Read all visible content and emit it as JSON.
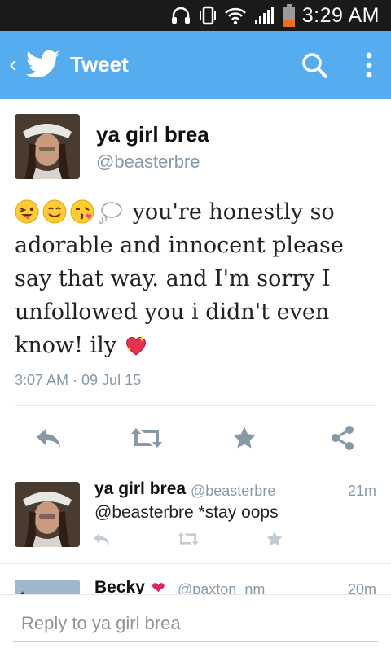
{
  "status_bar": {
    "time": "3:29 AM",
    "icons": [
      "headphones-icon",
      "vibrate-icon",
      "wifi-icon",
      "signal-icon",
      "battery-icon"
    ]
  },
  "app_bar": {
    "back_label": "‹",
    "title": "Tweet",
    "icons": [
      "twitter-bird-icon",
      "search-icon",
      "more-options-icon"
    ],
    "color": "#55acee"
  },
  "tweet": {
    "display_name": "ya girl brea",
    "handle": "@beasterbre",
    "text": "you're honestly so adorable and innocent please say that way. and I'm sorry I unfollowed you i didn't even know! ily",
    "leading_emoji": [
      "stuck-out-tongue-winking-emoji",
      "smiling-face-emoji",
      "kissing-face-emoji",
      "thought-balloon-emoji"
    ],
    "trailing_emoji": [
      "sparkling-heart-emoji"
    ],
    "timestamp": "3:07 AM · 09 Jul 15",
    "actions": [
      "reply-icon",
      "retweet-icon",
      "favorite-icon",
      "share-icon"
    ]
  },
  "replies": [
    {
      "display_name": "ya girl brea",
      "handle": "@beasterbre",
      "time": "21m",
      "text": "@beasterbre *stay oops",
      "actions": [
        "reply-icon",
        "retweet-icon",
        "favorite-icon"
      ]
    },
    {
      "display_name": "Becky",
      "heart": "❤",
      "handle": "@paxton_nm",
      "time": "20m"
    }
  ],
  "compose": {
    "placeholder": "Reply to ya girl brea"
  },
  "colors": {
    "twitter_blue": "#55acee",
    "action_gray": "#8899a6",
    "heart_red": "#e0245e"
  }
}
